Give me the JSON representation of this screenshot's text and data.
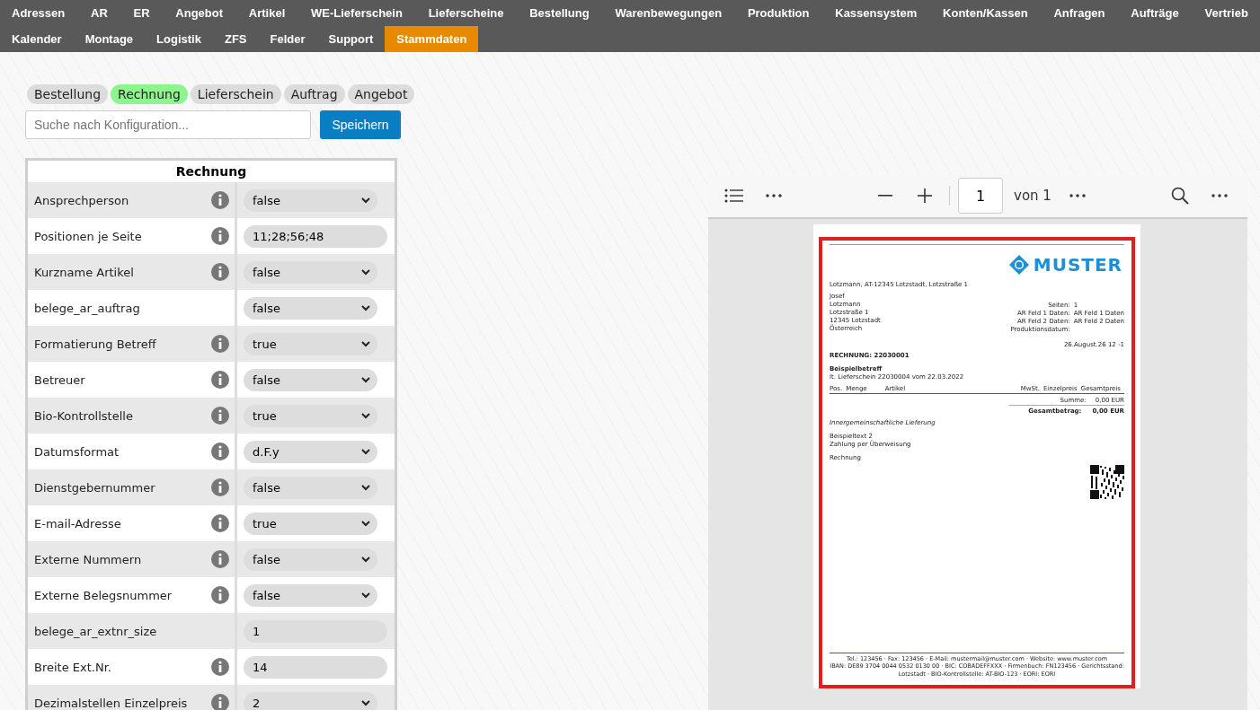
{
  "nav_rows": [
    [
      {
        "label": "Adressen",
        "selected": false
      },
      {
        "label": "AR",
        "selected": false
      },
      {
        "label": "ER",
        "selected": false
      },
      {
        "label": "Angebot",
        "selected": false
      },
      {
        "label": "Artikel",
        "selected": false
      },
      {
        "label": "WE-Lieferschein",
        "selected": false
      },
      {
        "label": "Lieferscheine",
        "selected": false
      },
      {
        "label": "Bestellung",
        "selected": false
      },
      {
        "label": "Warenbewegungen",
        "selected": false
      },
      {
        "label": "Produktion",
        "selected": false
      },
      {
        "label": "Kassensystem",
        "selected": false
      },
      {
        "label": "Konten/Kassen",
        "selected": false
      },
      {
        "label": "Anfragen",
        "selected": false
      },
      {
        "label": "Aufträge",
        "selected": false
      },
      {
        "label": "Vertrieb",
        "selected": false
      }
    ],
    [
      {
        "label": "Kalender",
        "selected": false
      },
      {
        "label": "Montage",
        "selected": false
      },
      {
        "label": "Logistik",
        "selected": false
      },
      {
        "label": "ZFS",
        "selected": false
      },
      {
        "label": "Felder",
        "selected": false
      },
      {
        "label": "Support",
        "selected": false
      },
      {
        "label": "Stammdaten",
        "selected": true
      }
    ]
  ],
  "doc_tabs": [
    {
      "label": "Bestellung",
      "selected": false
    },
    {
      "label": "Rechnung",
      "selected": true
    },
    {
      "label": "Lieferschein",
      "selected": false
    },
    {
      "label": "Auftrag",
      "selected": false
    },
    {
      "label": "Angebot",
      "selected": false
    }
  ],
  "search": {
    "placeholder": "Suche nach Konfiguration..."
  },
  "save_button": "Speichern",
  "config_table": {
    "title": "Rechnung",
    "rows": [
      {
        "label": "Ansprechperson",
        "info": true,
        "kind": "select",
        "value": "false"
      },
      {
        "label": "Positionen je Seite",
        "info": true,
        "kind": "text",
        "value": "11;28;56;48"
      },
      {
        "label": "Kurzname Artikel",
        "info": true,
        "kind": "select",
        "value": "false"
      },
      {
        "label": "belege_ar_auftrag",
        "info": false,
        "kind": "select",
        "value": "false"
      },
      {
        "label": "Formatierung Betreff",
        "info": true,
        "kind": "select",
        "value": "true"
      },
      {
        "label": "Betreuer",
        "info": true,
        "kind": "select",
        "value": "false"
      },
      {
        "label": "Bio-Kontrollstelle",
        "info": true,
        "kind": "select",
        "value": "true"
      },
      {
        "label": "Datumsformat",
        "info": true,
        "kind": "select",
        "value": "d.F.y"
      },
      {
        "label": "Dienstgebernummer",
        "info": true,
        "kind": "select",
        "value": "false"
      },
      {
        "label": "E-mail-Adresse",
        "info": true,
        "kind": "select",
        "value": "true"
      },
      {
        "label": "Externe Nummern",
        "info": true,
        "kind": "select",
        "value": "false"
      },
      {
        "label": "Externe Belegsnummer",
        "info": true,
        "kind": "select",
        "value": "false"
      },
      {
        "label": "belege_ar_extnr_size",
        "info": false,
        "kind": "text",
        "value": "1"
      },
      {
        "label": "Breite Ext.Nr.",
        "info": true,
        "kind": "text",
        "value": "14"
      },
      {
        "label": "Dezimalstellen Einzelpreis",
        "info": true,
        "kind": "select",
        "value": "2"
      }
    ]
  },
  "pdf_viewer": {
    "page_input": "1",
    "page_count": "von 1"
  },
  "document": {
    "logo": "MUSTER",
    "sender_line": "Lotzmann, AT-12345 Lotzstadt, Lotzstraße 1",
    "address": [
      "Josef",
      "Lotzmann",
      "Lotzstraße 1",
      "12345 Lotzstadt",
      "Österreich"
    ],
    "info": [
      {
        "label": "Seiten:",
        "value": "1"
      },
      {
        "label": "AR Feld 1 Daten:",
        "value": "AR Feld 1 Daten"
      },
      {
        "label": "AR Feld 2 Daten:",
        "value": "AR Feld 2 Daten"
      },
      {
        "label": "Produktionsdatum:"
      }
    ],
    "date": "26.August.26 12 -1",
    "title": "RECHNUNG: 22030001",
    "subject": "Beispielbetreff",
    "reference": "lt. Lieferschein 22030004 vom 22.03.2022",
    "columns": [
      "Pos.",
      "Menge",
      "Artikel",
      "MwSt.",
      "Einzelpreis",
      "Gesamtpreis"
    ],
    "sum": {
      "label": "Summe:",
      "value": "0,00 EUR"
    },
    "total": {
      "label": "Gesamtbetrag:",
      "value": "0,00 EUR"
    },
    "note": "Innergemeinschaftliche Lieferung",
    "texts": [
      "Beispieltext 2",
      "Zahlung per Überweisung"
    ],
    "closing": "Rechnung",
    "footer": [
      "Tel.: 123456  ·  Fax: 123456  ·  E-Mail: mustermail@muster.com  ·  Website: www.muster.com",
      "IBAN: DE89 3704 0044 0532 0130 00  ·  BIC: COBADEFFXXX  ·  Firmenbuch: FN123456  ·  Gerichtsstand: Lotzstadt  ·  BIO-Kontrollstelle: AT-BIO-123  ·  EORI: EORI"
    ]
  }
}
